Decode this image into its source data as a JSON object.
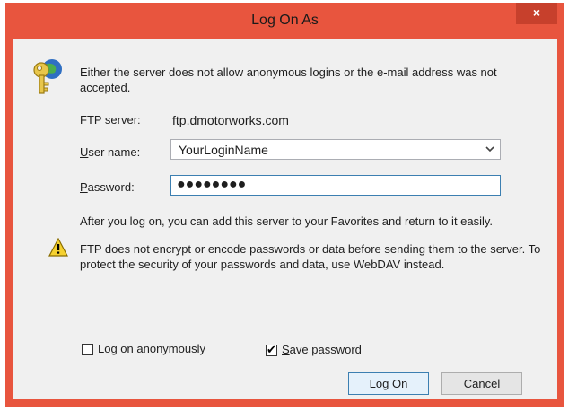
{
  "window": {
    "title": "Log On As",
    "close_label": "×"
  },
  "message": "Either the server does not allow anonymous logins or the e-mail address was not accepted.",
  "ftp_server": {
    "label": "FTP server:",
    "value": "ftp.dmotorworks.com"
  },
  "user_name": {
    "label_prefix": "U",
    "label_rest": "ser name:",
    "value": "YourLoginName"
  },
  "password": {
    "label_prefix": "P",
    "label_rest": "assword:",
    "value": "●●●●●●●●"
  },
  "favorites_note": "After you log on, you can add this server to your Favorites and return to it easily.",
  "warning_text": "FTP does not encrypt or encode passwords or data before sending them to the server.  To protect the security of your passwords and data, use WebDAV instead.",
  "options": {
    "anonymous": {
      "prefix": "Log on ",
      "accel": "a",
      "rest": "nonymously",
      "checked": false
    },
    "save_password": {
      "accel": "S",
      "rest": "ave password",
      "checked": true
    }
  },
  "buttons": {
    "log_on_accel": "L",
    "log_on_rest": "og On",
    "cancel": "Cancel"
  },
  "colors": {
    "title_bar": "#e8553e",
    "client_bg": "#f0f0f0",
    "focus_border": "#3c7fb1"
  },
  "icons": [
    "key-globe-icon",
    "warning-icon",
    "chevron-down-icon",
    "close-icon",
    "checkmark-icon"
  ]
}
